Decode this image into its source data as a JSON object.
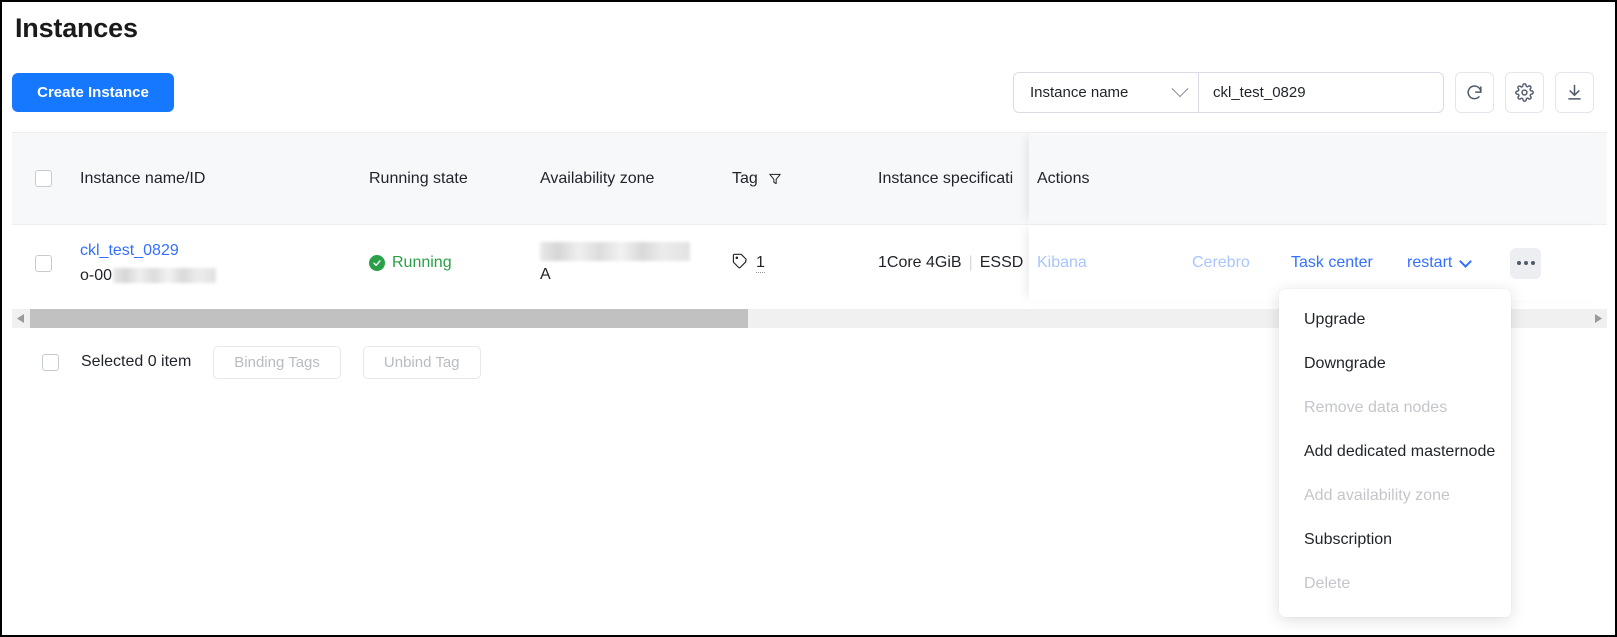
{
  "page": {
    "title": "Instances"
  },
  "toolbar": {
    "create_label": "Create Instance",
    "search": {
      "select_value": "Instance name",
      "input_value": "ckl_test_0829",
      "input_placeholder": ""
    },
    "icons": {
      "refresh": "refresh-icon",
      "settings": "gear-icon",
      "download": "download-icon"
    }
  },
  "table": {
    "columns": [
      {
        "key": "name",
        "label": "Instance name/ID"
      },
      {
        "key": "state",
        "label": "Running state"
      },
      {
        "key": "az",
        "label": "Availability zone"
      },
      {
        "key": "tag",
        "label": "Tag",
        "filter_icon": "filter-icon"
      },
      {
        "key": "spec",
        "label": "Instance specificati"
      },
      {
        "key": "act",
        "label": "Actions"
      }
    ],
    "rows": [
      {
        "instance_name": "ckl_test_0829",
        "instance_id_prefix": "o-00",
        "instance_id_redacted": true,
        "state": "Running",
        "state_color": "#2aa048",
        "availability_zone_redacted": true,
        "availability_zone_line2": "A",
        "tag_count": "1",
        "spec_cpu": "1Core 4GiB",
        "spec_sep": "|",
        "spec_disk": "ESSD",
        "actions": [
          {
            "label": "Kibana",
            "disabled": true
          },
          {
            "label": "Cerebro",
            "disabled": true
          },
          {
            "label": "Task center",
            "disabled": false
          },
          {
            "label": "restart",
            "disabled": false,
            "has_caret": true
          }
        ],
        "more_label": "..."
      }
    ]
  },
  "bottom": {
    "selected_text": "Selected 0 item",
    "binding_tags_label": "Binding Tags",
    "unbind_tag_label": "Unbind Tag"
  },
  "menu": {
    "items": [
      {
        "label": "Upgrade",
        "disabled": false
      },
      {
        "label": "Downgrade",
        "disabled": false
      },
      {
        "label": "Remove data nodes",
        "disabled": true
      },
      {
        "label": "Add dedicated masternode",
        "disabled": false
      },
      {
        "label": "Add availability zone",
        "disabled": true
      },
      {
        "label": "Subscription",
        "disabled": false
      },
      {
        "label": "Delete",
        "disabled": true
      }
    ]
  },
  "colors": {
    "primary": "#1677ff",
    "link": "#3370ff",
    "link_disabled": "#a8c5ff",
    "success": "#2aa048",
    "header_bg": "#f7f8fa"
  }
}
